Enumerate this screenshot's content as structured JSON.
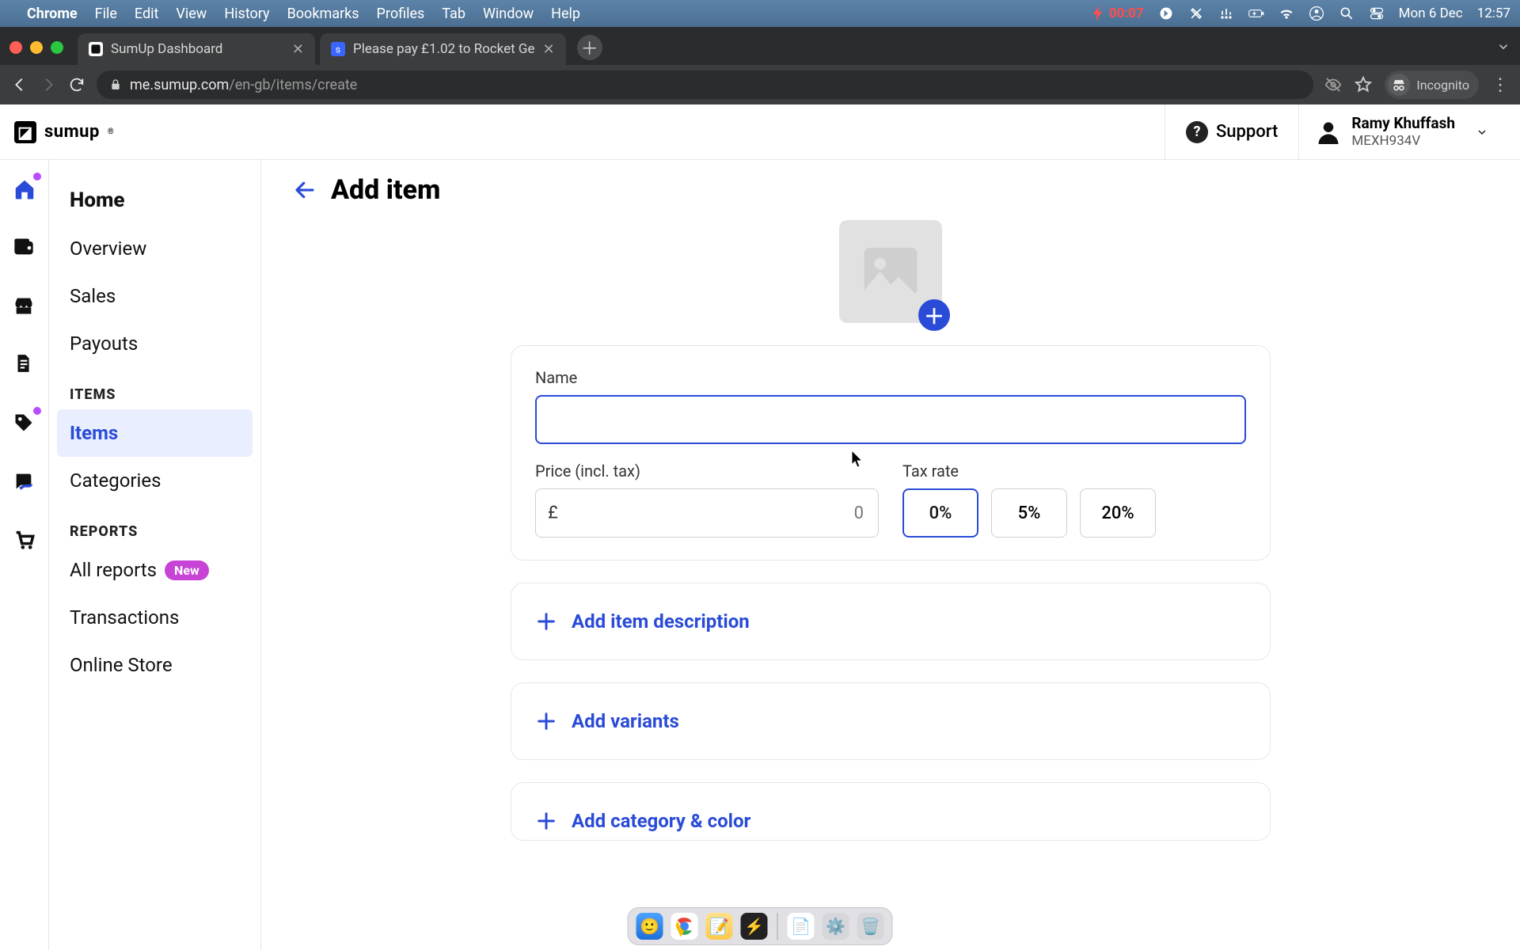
{
  "mac_menu": {
    "app": "Chrome",
    "items": [
      "File",
      "Edit",
      "View",
      "History",
      "Bookmarks",
      "Profiles",
      "Tab",
      "Window",
      "Help"
    ],
    "battery_time": "00:07",
    "date": "Mon 6 Dec",
    "clock": "12:57"
  },
  "browser": {
    "tabs": [
      {
        "title": "SumUp Dashboard",
        "active": true
      },
      {
        "title": "Please pay £1.02 to Rocket Ge",
        "active": false
      }
    ],
    "url_host": "me.sumup.com",
    "url_path": "/en-gb/items/create",
    "incognito_label": "Incognito"
  },
  "app_header": {
    "brand": "sumup",
    "support": "Support",
    "user_name": "Ramy Khuffash",
    "user_code": "MEXH934V"
  },
  "sidebar": {
    "home": "Home",
    "links_top": [
      "Overview",
      "Sales",
      "Payouts"
    ],
    "items_heading": "ITEMS",
    "items_links": [
      "Items",
      "Categories"
    ],
    "reports_heading": "REPORTS",
    "all_reports": "All reports",
    "new_badge": "New",
    "reports_links": [
      "Transactions",
      "Online Store"
    ]
  },
  "page": {
    "title": "Add item",
    "name_label": "Name",
    "name_value": "",
    "price_label": "Price (incl. tax)",
    "price_currency": "£",
    "price_placeholder": "0",
    "price_value": "",
    "tax_label": "Tax rate",
    "tax_options": [
      "0%",
      "5%",
      "20%"
    ],
    "tax_selected": "0%",
    "add_description": "Add item description",
    "add_variants": "Add variants",
    "add_category": "Add category & color"
  },
  "dock": {
    "items": [
      "finder",
      "chrome",
      "notes",
      "bolt",
      "sep",
      "textedit",
      "prefs",
      "trash"
    ]
  }
}
